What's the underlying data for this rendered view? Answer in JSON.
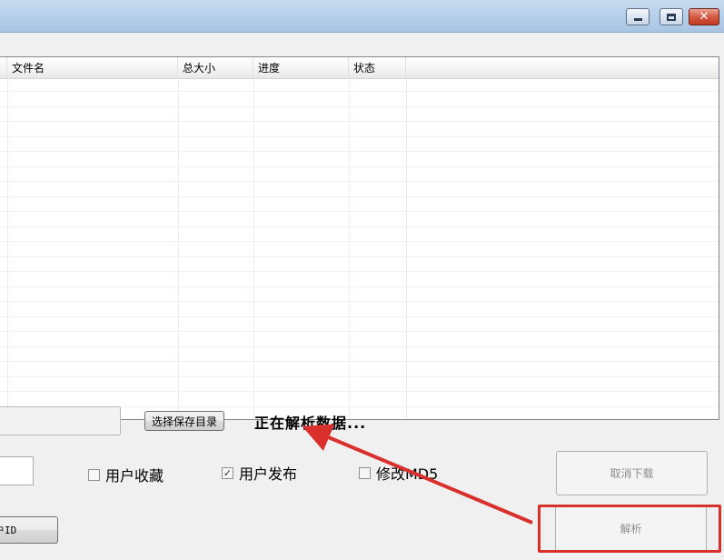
{
  "window": {
    "close_glyph": "✕"
  },
  "list": {
    "columns": [
      "文件名",
      "总大小",
      "进度",
      "状态"
    ]
  },
  "controls": {
    "save_dir_button": "选择保存目录",
    "status_message": "正在解析数据...",
    "checkbox_favorites": {
      "label": "用户收藏",
      "checked": false
    },
    "checkbox_publish": {
      "label": "用户发布",
      "checked": true
    },
    "checkbox_md5": {
      "label": "修改MD5",
      "checked": false
    },
    "cancel_download_button": "取消下载",
    "parse_button": "解析",
    "user_id_button": "户ID"
  },
  "annotation": {
    "color": "#d9302c"
  }
}
